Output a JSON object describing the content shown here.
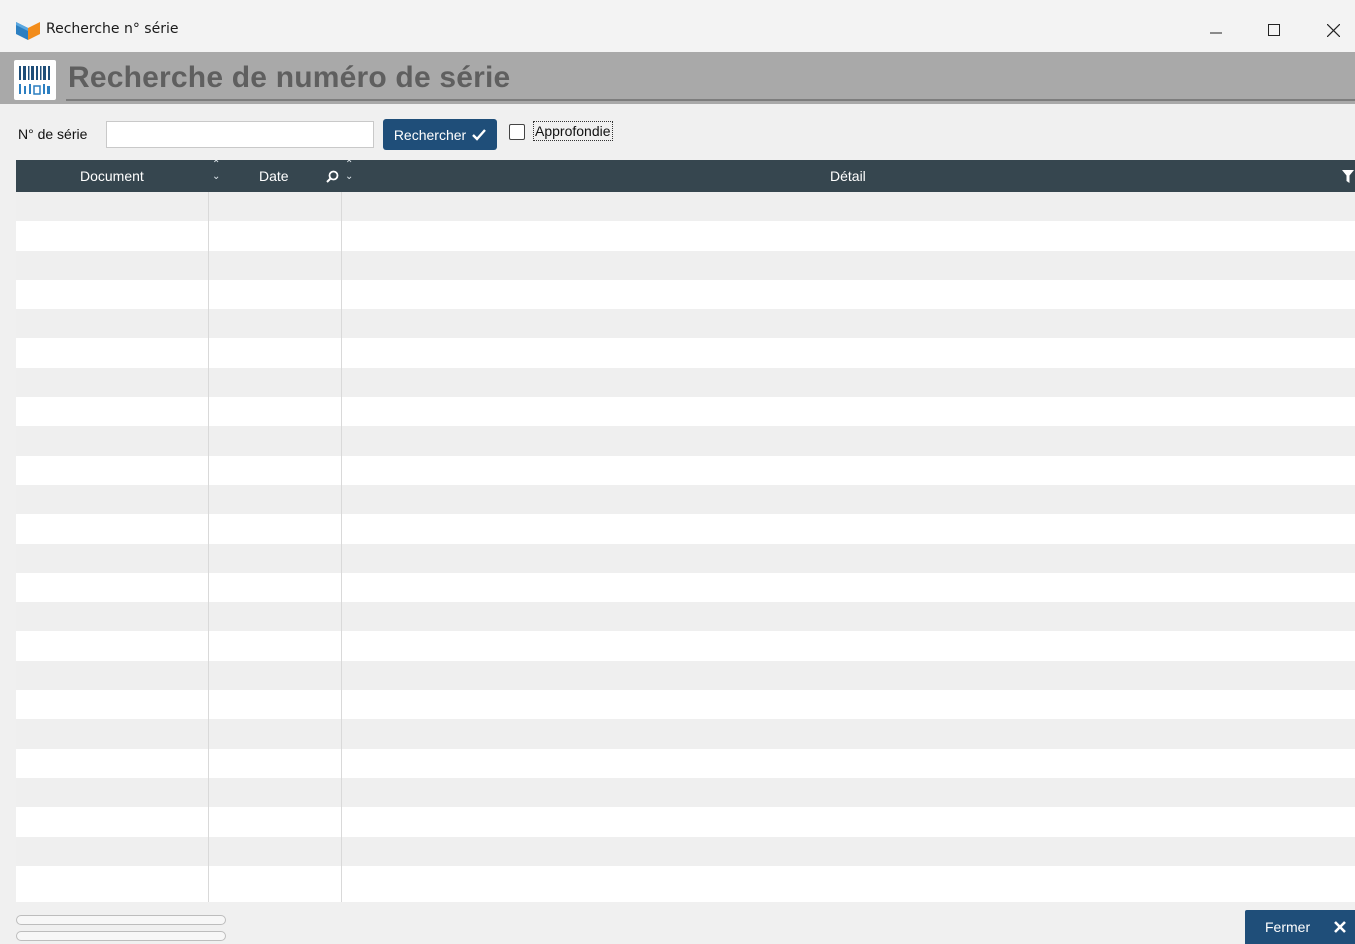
{
  "window": {
    "title": "Recherche n° série",
    "minimize_icon": "minimize-icon",
    "maximize_icon": "maximize-icon",
    "close_icon": "close-icon"
  },
  "banner": {
    "title": "Recherche de numéro de série",
    "icon": "barcode-icon"
  },
  "search": {
    "label": "N° de série",
    "value": "",
    "button_label": "Rechercher",
    "button_icon": "checkmark-icon",
    "deep_checkbox_label": "Approfondie",
    "deep_checked": false
  },
  "grid": {
    "columns": [
      {
        "label": "Document",
        "icon": "sort-icon"
      },
      {
        "label": "Date",
        "icon": "search-icon"
      },
      {
        "label": "Détail",
        "icon": "filter-icon"
      }
    ],
    "rows": []
  },
  "footer": {
    "close_label": "Fermer",
    "close_icon": "close-icon"
  },
  "colors": {
    "accent": "#1f4e79",
    "grid_header": "#36464f",
    "banner": "#a9a9a9"
  }
}
